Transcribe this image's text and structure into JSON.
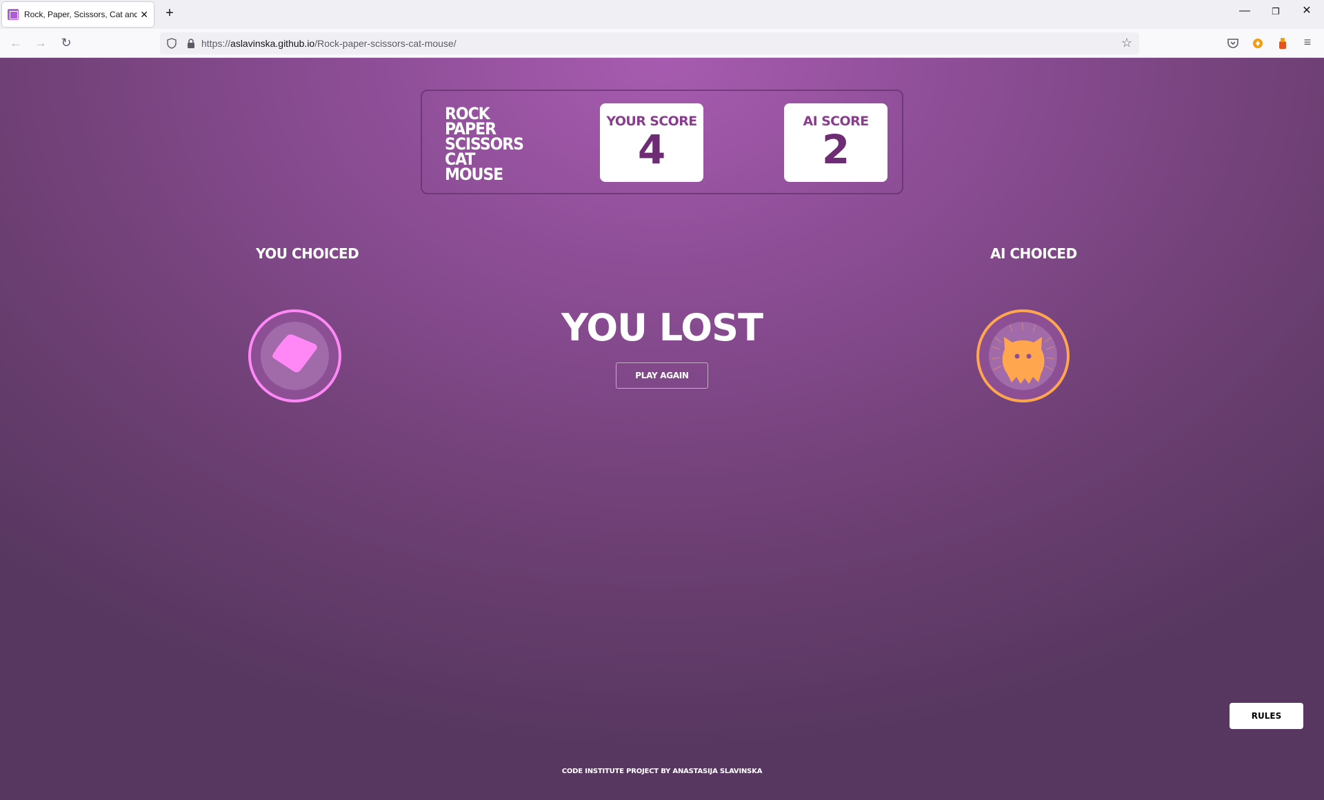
{
  "browser": {
    "tab_title": "Rock, Paper, Scissors, Cat and M",
    "url_scheme": "https://",
    "url_host": "aslavinska.github.io",
    "url_path": "/Rock-paper-scissors-cat-mouse/"
  },
  "scoreboard": {
    "title_lines": [
      "ROCK",
      "PAPER",
      "SCISSORS",
      "CAT",
      "MOUSE"
    ],
    "your_score_label": "YOUR SCORE",
    "your_score": "4",
    "ai_score_label": "AI SCORE",
    "ai_score": "2"
  },
  "game": {
    "you_choiced_label": "YOU CHOICED",
    "ai_choiced_label": "AI CHOICED",
    "you_choice_icon": "paper-icon",
    "ai_choice_icon": "cat-icon",
    "result": "YOU LOST",
    "play_again_label": "PLAY AGAIN"
  },
  "rules_label": "RULES",
  "footer": "CODE INSTITUTE PROJECT BY ANASTASIJA SLAVINSKA",
  "colors": {
    "paper_accent": "#ff88f6",
    "cat_accent": "#ffa64f",
    "score_text": "#6e2c74"
  }
}
